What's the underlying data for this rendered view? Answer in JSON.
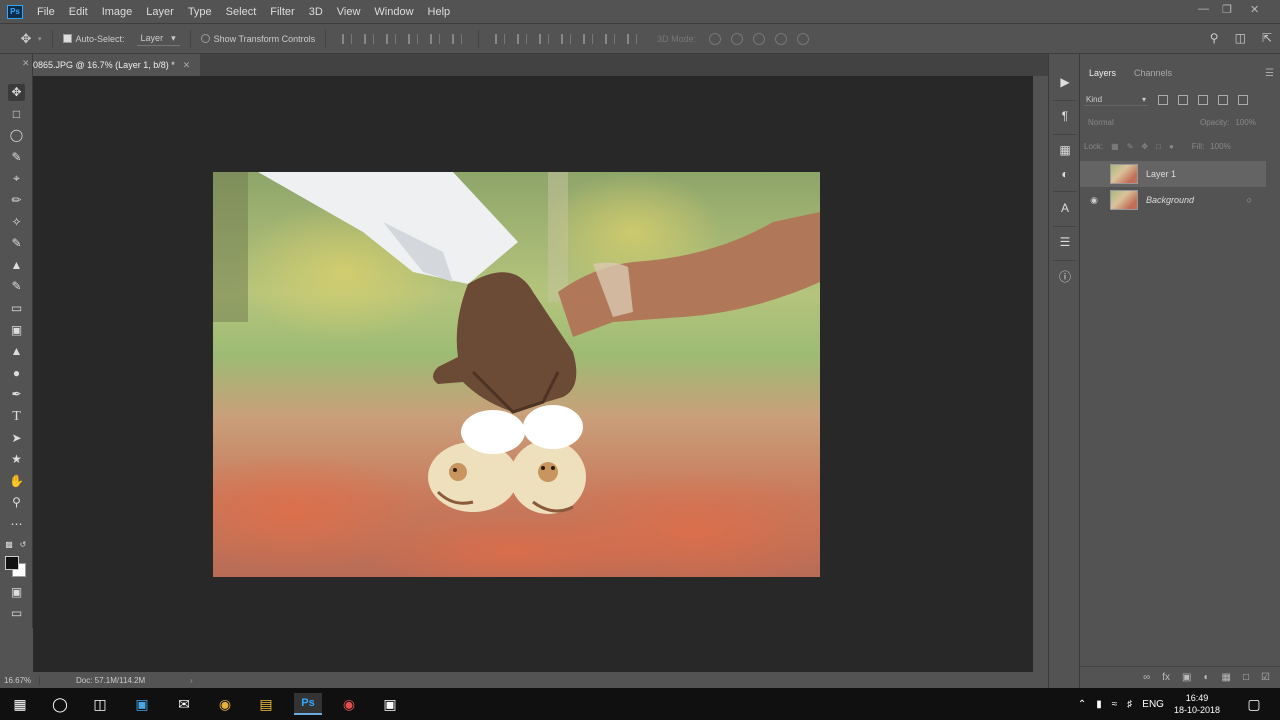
{
  "app": {
    "logo": "Ps"
  },
  "menu": [
    "File",
    "Edit",
    "Image",
    "Layer",
    "Type",
    "Select",
    "Filter",
    "3D",
    "View",
    "Window",
    "Help"
  ],
  "options": {
    "auto_select_label": "Auto-Select:",
    "auto_select_value": "Layer",
    "transform_label": "Show Transform Controls",
    "mode3d_label": "3D Mode:"
  },
  "document": {
    "tab_title": "0865.JPG @ 16.7% (Layer 1, b/8) *"
  },
  "status": {
    "zoom": "16.67%",
    "doc_info": "Doc: 57.1M/114.2M"
  },
  "layers_panel": {
    "tabs": [
      "Layers",
      "Channels"
    ],
    "kind_label": "Kind",
    "blend_mode": "Normal",
    "opacity_label": "Opacity:",
    "opacity_value": "100%",
    "lock_label": "Lock:",
    "fill_label": "Fill:",
    "fill_value": "100%",
    "layers": [
      {
        "name": "Layer 1",
        "selected": true,
        "visible": false
      },
      {
        "name": "Background",
        "selected": false,
        "visible": true,
        "locked": true
      }
    ]
  },
  "taskbar": {
    "tray_lang": "ENG",
    "time": "16:49",
    "date": "18-10-2018"
  },
  "colors": {
    "accent": "#31a8ff",
    "canvas_bg": "#282828",
    "ui_bg": "#535353"
  }
}
